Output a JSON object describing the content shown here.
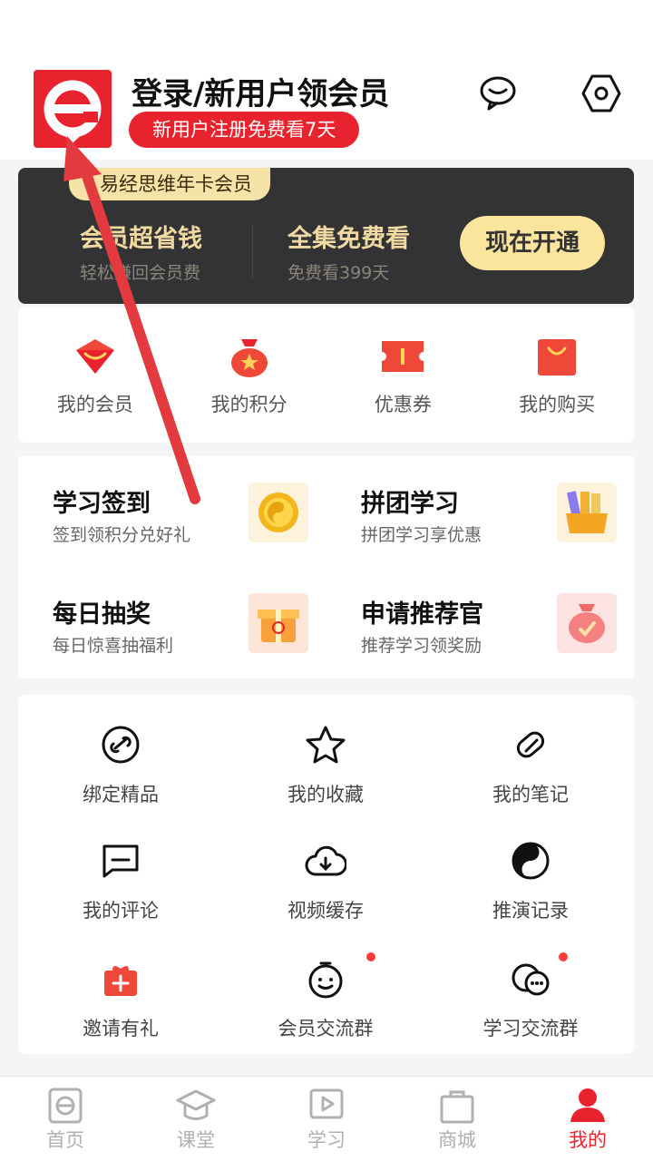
{
  "header": {
    "login_title": "登录/新用户领会员",
    "register_badge": "新用户注册免费看7天",
    "icons": [
      "message-icon",
      "settings-icon"
    ]
  },
  "vip_card": {
    "tag": "易经思维年卡会员",
    "col1_title": "会员超省钱",
    "col1_sub": "轻松赚回会员费",
    "col2_title": "全集免费看",
    "col2_sub": "免费看399天",
    "open_button": "现在开通"
  },
  "quick_links": [
    {
      "label": "我的会员",
      "icon": "vip-gem-icon"
    },
    {
      "label": "我的积分",
      "icon": "points-bag-icon"
    },
    {
      "label": "优惠券",
      "icon": "coupon-icon"
    },
    {
      "label": "我的购买",
      "icon": "shopping-bag-icon"
    }
  ],
  "features": [
    {
      "title": "学习签到",
      "subtitle": "签到领积分兑好礼",
      "icon": "gold-coin-icon"
    },
    {
      "title": "拼团学习",
      "subtitle": "拼团学习享优惠",
      "icon": "books-box-icon"
    },
    {
      "title": "每日抽奖",
      "subtitle": "每日惊喜抽福利",
      "icon": "gift-box-icon"
    },
    {
      "title": "申请推荐官",
      "subtitle": "推荐学习领奖励",
      "icon": "reward-bag-icon"
    }
  ],
  "tools": [
    {
      "label": "绑定精品",
      "icon": "link-icon"
    },
    {
      "label": "我的收藏",
      "icon": "star-icon"
    },
    {
      "label": "我的笔记",
      "icon": "note-pen-icon"
    },
    {
      "label": "我的评论",
      "icon": "comment-icon"
    },
    {
      "label": "视频缓存",
      "icon": "cloud-download-icon"
    },
    {
      "label": "推演记录",
      "icon": "yin-yang-icon"
    },
    {
      "label": "邀请有礼",
      "icon": "gift-icon"
    },
    {
      "label": "会员交流群",
      "icon": "member-chat-icon"
    },
    {
      "label": "学习交流群",
      "icon": "study-chat-icon"
    }
  ],
  "tabbar": [
    {
      "label": "首页",
      "icon": "home-icon",
      "active": false
    },
    {
      "label": "课堂",
      "icon": "graduation-cap-icon",
      "active": false
    },
    {
      "label": "学习",
      "icon": "play-icon",
      "active": false
    },
    {
      "label": "商城",
      "icon": "shop-bag-icon",
      "active": false
    },
    {
      "label": "我的",
      "icon": "user-icon",
      "active": true
    }
  ],
  "colors": {
    "brand_red": "#e8232d",
    "gold": "#f1d9a2",
    "dark_card": "#333336"
  }
}
